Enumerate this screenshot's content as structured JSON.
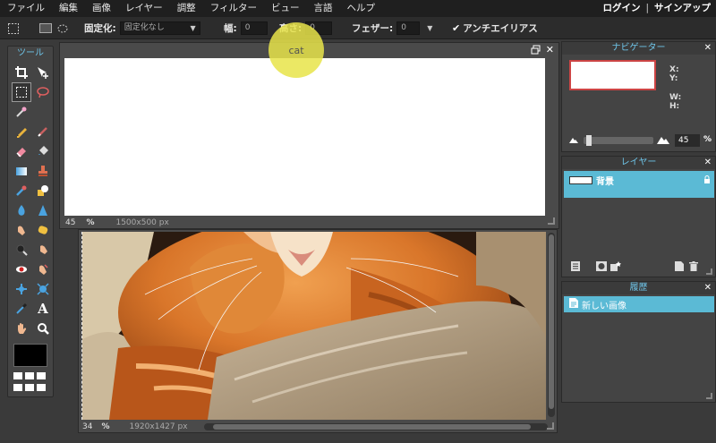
{
  "menu": {
    "items": [
      "ファイル",
      "編集",
      "画像",
      "レイヤー",
      "調整",
      "フィルター",
      "ビュー",
      "言語",
      "ヘルプ"
    ],
    "login": "ログイン",
    "separator": "|",
    "signup": "サインアップ"
  },
  "options": {
    "fixed_label": "固定化:",
    "fixed_value": "固定化なし",
    "width_label": "幅:",
    "width_value": "0",
    "height_label": "高さ:",
    "height_value": "0",
    "feather_label": "フェザー:",
    "feather_value": "0",
    "antialias_label": "アンチエイリアス",
    "antialias_checked": true
  },
  "tools": {
    "title": "ツール"
  },
  "tooltip": {
    "text": "cat"
  },
  "window1": {
    "zoom": "45",
    "zoom_unit": "%",
    "size": "1500x500 px"
  },
  "window2": {
    "zoom": "34",
    "zoom_unit": "%",
    "size": "1920x1427 px"
  },
  "navigator": {
    "title": "ナビゲーター",
    "x_label": "X:",
    "y_label": "Y:",
    "w_label": "W:",
    "h_label": "H:",
    "zoom_value": "45",
    "zoom_unit": "%"
  },
  "layers": {
    "title": "レイヤー",
    "items": [
      {
        "name": "背景"
      }
    ]
  },
  "history": {
    "title": "履歴",
    "items": [
      {
        "label": "新しい画像"
      }
    ]
  },
  "colors": {
    "accent": "#5bbad5",
    "panel_title": "#6ec4e8",
    "bubble": "#e8e44a"
  }
}
